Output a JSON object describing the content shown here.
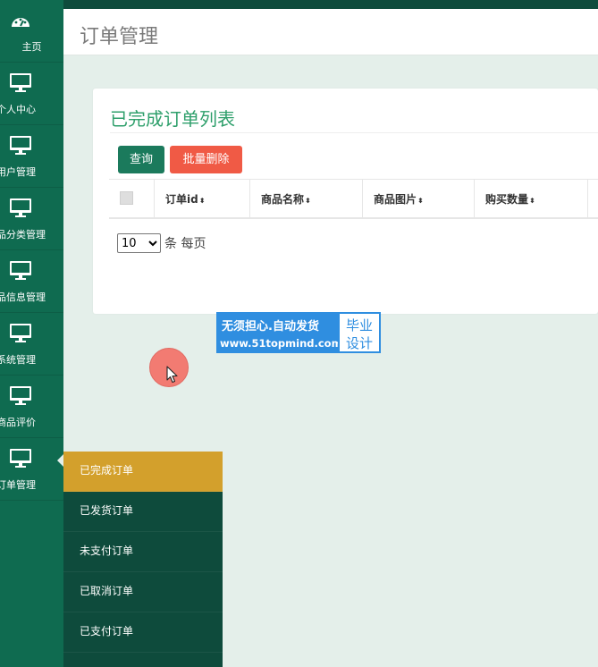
{
  "sidebar": {
    "items": [
      {
        "label": "主页",
        "icon": "dashboard-icon"
      },
      {
        "label": "个人中心",
        "icon": "monitor-icon"
      },
      {
        "label": "用户管理",
        "icon": "monitor-icon"
      },
      {
        "label": "品分类管理",
        "icon": "monitor-icon"
      },
      {
        "label": "品信息管理",
        "icon": "monitor-icon"
      },
      {
        "label": "系统管理",
        "icon": "monitor-icon"
      },
      {
        "label": "商品评价",
        "icon": "monitor-icon"
      },
      {
        "label": "订单管理",
        "icon": "monitor-icon"
      }
    ]
  },
  "header": {
    "title": "订单管理"
  },
  "card": {
    "title": "已完成订单列表",
    "query_button": "查询",
    "batch_delete_button": "批量删除"
  },
  "table": {
    "columns": [
      "订单id",
      "商品名称",
      "商品图片",
      "购买数量"
    ],
    "sort_glyph": "⬍"
  },
  "pager": {
    "page_size": "10",
    "suffix": "条 每页"
  },
  "watermark": {
    "line1": "无须担心.自动发货",
    "line2": "www.51topmind.com",
    "right1": "毕业",
    "right2": "设计"
  },
  "submenu": {
    "items": [
      "已完成订单",
      "已发货订单",
      "未支付订单",
      "已取消订单",
      "已支付订单"
    ]
  },
  "colors": {
    "sidebar": "#0f6b50",
    "submenu": "#0e4b3c",
    "submenu_active": "#d3a02c",
    "title_green": "#2e9f6b",
    "query_btn": "#1b7a5c",
    "delete_btn": "#f05a45"
  }
}
